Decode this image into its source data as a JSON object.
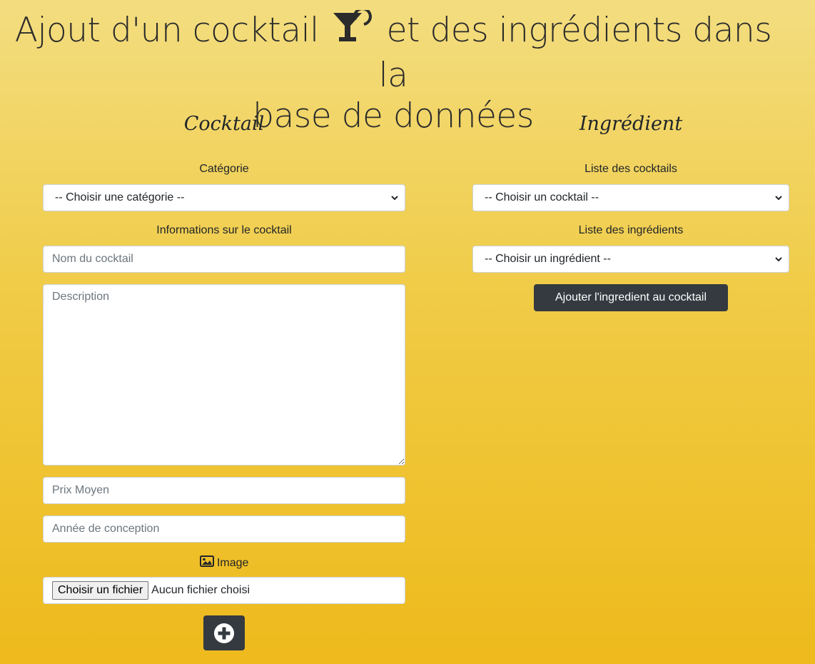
{
  "title": {
    "line1_before": "Ajout d'un cocktail",
    "line1_after": "et des ingrédients dans la",
    "line2": "base de données",
    "icon": "cocktail-glass-icon"
  },
  "cocktail": {
    "heading": "Cocktail",
    "category_label": "Catégorie",
    "category_selected": "-- Choisir une catégorie --",
    "info_label": "Informations sur le cocktail",
    "name_placeholder": "Nom du cocktail",
    "description_placeholder": "Description",
    "price_placeholder": "Prix Moyen",
    "year_placeholder": "Année de conception",
    "image_label": "Image",
    "image_icon": "image-icon",
    "file_button": "Choisir un fichier",
    "file_status": "Aucun fichier choisi",
    "submit_icon": "plus-circle-icon"
  },
  "ingredient": {
    "heading": "Ingrédient",
    "cocktails_label": "Liste des cocktails",
    "cocktail_selected": "-- Choisir un cocktail --",
    "ingredients_label": "Liste des ingrédients",
    "ingredient_selected": "-- Choisir un ingrédient --",
    "add_button": "Ajouter l'ingredient au cocktail"
  },
  "colors": {
    "background_top": "#f3dd80",
    "background_bottom": "#eeba1c",
    "dark_button": "#343a40"
  }
}
